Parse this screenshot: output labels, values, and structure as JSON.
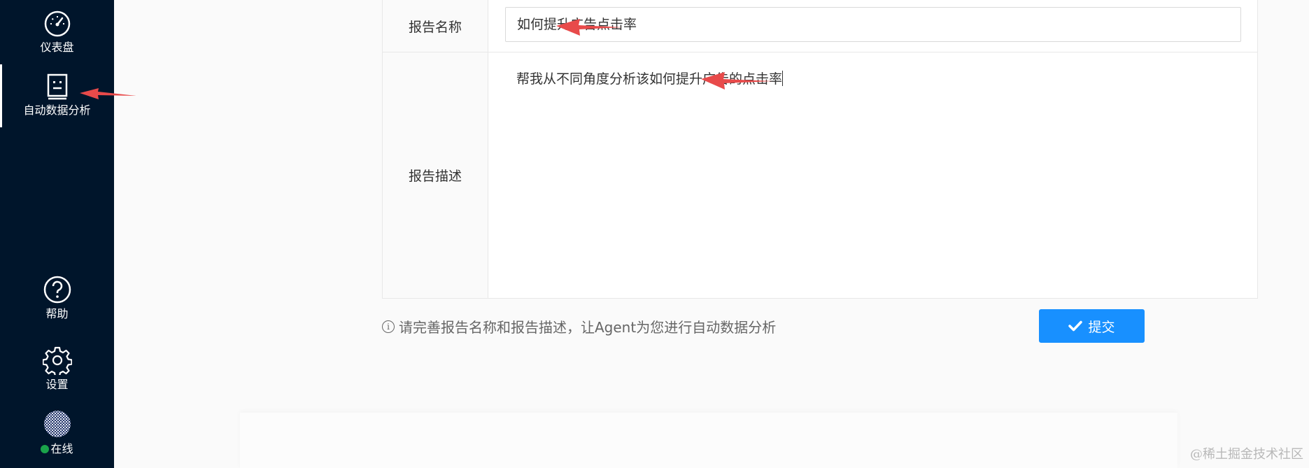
{
  "sidebar": {
    "items": [
      {
        "label": "仪表盘",
        "icon": "dashboard-gauge-icon"
      },
      {
        "label": "自动数据分析",
        "icon": "report-document-icon",
        "active": true
      },
      {
        "label": "帮助",
        "icon": "help-question-icon"
      },
      {
        "label": "设置",
        "icon": "gear-icon"
      }
    ],
    "status": {
      "label": "在线",
      "dot_color": "#1aa34a"
    }
  },
  "form": {
    "name_label": "报告名称",
    "name_value": "如何提升广告点击率",
    "desc_label": "报告描述",
    "desc_value": "帮我从不同角度分析该如何提升广告的点击率"
  },
  "hint": {
    "text": "请完善报告名称和报告描述，让Agent为您进行自动数据分析"
  },
  "submit": {
    "label": "提交"
  },
  "watermark": "@稀土掘金技术社区",
  "colors": {
    "sidebar_bg": "#00152b",
    "primary": "#1890ff",
    "arrow": "#e84a4a"
  }
}
